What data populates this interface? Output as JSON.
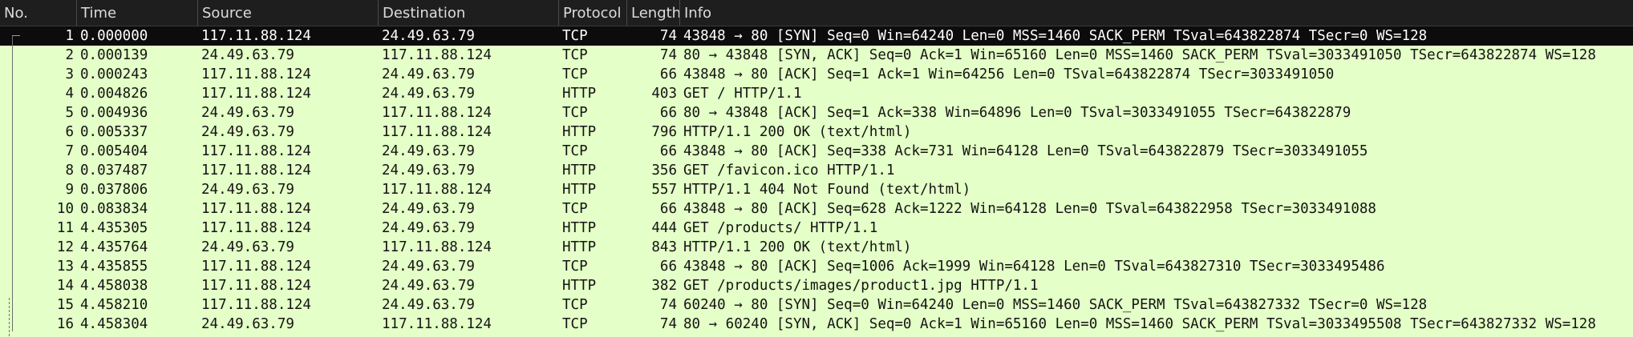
{
  "columns": {
    "no": "No.",
    "time": "Time",
    "source": "Source",
    "destination": "Destination",
    "protocol": "Protocol",
    "length": "Length",
    "info": "Info"
  },
  "colors": {
    "row_background": "#e4ffc7",
    "selected_background": "#0c0c0c",
    "header_background": "#1e1e1e"
  },
  "packets": [
    {
      "no": "1",
      "time": "0.000000",
      "source": "117.11.88.124",
      "destination": "24.49.63.79",
      "protocol": "TCP",
      "length": "74",
      "info": "43848 → 80 [SYN] Seq=0 Win=64240 Len=0 MSS=1460 SACK_PERM TSval=643822874 TSecr=0 WS=128",
      "selected": true
    },
    {
      "no": "2",
      "time": "0.000139",
      "source": "24.49.63.79",
      "destination": "117.11.88.124",
      "protocol": "TCP",
      "length": "74",
      "info": "80 → 43848 [SYN, ACK] Seq=0 Ack=1 Win=65160 Len=0 MSS=1460 SACK_PERM TSval=3033491050 TSecr=643822874 WS=128"
    },
    {
      "no": "3",
      "time": "0.000243",
      "source": "117.11.88.124",
      "destination": "24.49.63.79",
      "protocol": "TCP",
      "length": "66",
      "info": "43848 → 80 [ACK] Seq=1 Ack=1 Win=64256 Len=0 TSval=643822874 TSecr=3033491050"
    },
    {
      "no": "4",
      "time": "0.004826",
      "source": "117.11.88.124",
      "destination": "24.49.63.79",
      "protocol": "HTTP",
      "length": "403",
      "info": "GET / HTTP/1.1"
    },
    {
      "no": "5",
      "time": "0.004936",
      "source": "24.49.63.79",
      "destination": "117.11.88.124",
      "protocol": "TCP",
      "length": "66",
      "info": "80 → 43848 [ACK] Seq=1 Ack=338 Win=64896 Len=0 TSval=3033491055 TSecr=643822879"
    },
    {
      "no": "6",
      "time": "0.005337",
      "source": "24.49.63.79",
      "destination": "117.11.88.124",
      "protocol": "HTTP",
      "length": "796",
      "info": "HTTP/1.1 200 OK  (text/html)"
    },
    {
      "no": "7",
      "time": "0.005404",
      "source": "117.11.88.124",
      "destination": "24.49.63.79",
      "protocol": "TCP",
      "length": "66",
      "info": "43848 → 80 [ACK] Seq=338 Ack=731 Win=64128 Len=0 TSval=643822879 TSecr=3033491055"
    },
    {
      "no": "8",
      "time": "0.037487",
      "source": "117.11.88.124",
      "destination": "24.49.63.79",
      "protocol": "HTTP",
      "length": "356",
      "info": "GET /favicon.ico HTTP/1.1"
    },
    {
      "no": "9",
      "time": "0.037806",
      "source": "24.49.63.79",
      "destination": "117.11.88.124",
      "protocol": "HTTP",
      "length": "557",
      "info": "HTTP/1.1 404 Not Found  (text/html)"
    },
    {
      "no": "10",
      "time": "0.083834",
      "source": "117.11.88.124",
      "destination": "24.49.63.79",
      "protocol": "TCP",
      "length": "66",
      "info": "43848 → 80 [ACK] Seq=628 Ack=1222 Win=64128 Len=0 TSval=643822958 TSecr=3033491088"
    },
    {
      "no": "11",
      "time": "4.435305",
      "source": "117.11.88.124",
      "destination": "24.49.63.79",
      "protocol": "HTTP",
      "length": "444",
      "info": "GET /products/ HTTP/1.1"
    },
    {
      "no": "12",
      "time": "4.435764",
      "source": "24.49.63.79",
      "destination": "117.11.88.124",
      "protocol": "HTTP",
      "length": "843",
      "info": "HTTP/1.1 200 OK  (text/html)"
    },
    {
      "no": "13",
      "time": "4.435855",
      "source": "117.11.88.124",
      "destination": "24.49.63.79",
      "protocol": "TCP",
      "length": "66",
      "info": "43848 → 80 [ACK] Seq=1006 Ack=1999 Win=64128 Len=0 TSval=643827310 TSecr=3033495486"
    },
    {
      "no": "14",
      "time": "4.458038",
      "source": "117.11.88.124",
      "destination": "24.49.63.79",
      "protocol": "HTTP",
      "length": "382",
      "info": "GET /products/images/product1.jpg HTTP/1.1"
    },
    {
      "no": "15",
      "time": "4.458210",
      "source": "117.11.88.124",
      "destination": "24.49.63.79",
      "protocol": "TCP",
      "length": "74",
      "info": "60240 → 80 [SYN] Seq=0 Win=64240 Len=0 MSS=1460 SACK_PERM TSval=643827332 TSecr=0 WS=128"
    },
    {
      "no": "16",
      "time": "4.458304",
      "source": "24.49.63.79",
      "destination": "117.11.88.124",
      "protocol": "TCP",
      "length": "74",
      "info": "80 → 60240 [SYN, ACK] Seq=0 Ack=1 Win=65160 Len=0 MSS=1460 SACK_PERM TSval=3033495508 TSecr=643827332 WS=128"
    }
  ]
}
